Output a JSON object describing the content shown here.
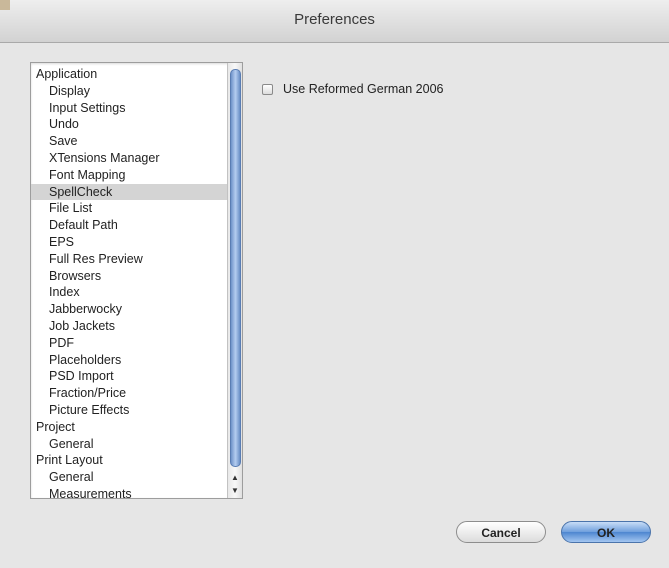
{
  "window": {
    "title": "Preferences"
  },
  "sidebar": {
    "items": [
      {
        "label": "Application",
        "level": 0
      },
      {
        "label": "Display",
        "level": 1
      },
      {
        "label": "Input Settings",
        "level": 1
      },
      {
        "label": "Undo",
        "level": 1
      },
      {
        "label": "Save",
        "level": 1
      },
      {
        "label": "XTensions Manager",
        "level": 1
      },
      {
        "label": "Font Mapping",
        "level": 1
      },
      {
        "label": "SpellCheck",
        "level": 1,
        "selected": true
      },
      {
        "label": "File List",
        "level": 1
      },
      {
        "label": "Default Path",
        "level": 1
      },
      {
        "label": "EPS",
        "level": 1
      },
      {
        "label": "Full Res Preview",
        "level": 1
      },
      {
        "label": "Browsers",
        "level": 1
      },
      {
        "label": "Index",
        "level": 1
      },
      {
        "label": "Jabberwocky",
        "level": 1
      },
      {
        "label": "Job Jackets",
        "level": 1
      },
      {
        "label": "PDF",
        "level": 1
      },
      {
        "label": "Placeholders",
        "level": 1
      },
      {
        "label": "PSD Import",
        "level": 1
      },
      {
        "label": "Fraction/Price",
        "level": 1
      },
      {
        "label": "Picture Effects",
        "level": 1
      },
      {
        "label": "Project",
        "level": 0
      },
      {
        "label": "General",
        "level": 1
      },
      {
        "label": "Print Layout",
        "level": 0
      },
      {
        "label": "General",
        "level": 1
      },
      {
        "label": "Measurements",
        "level": 1
      }
    ]
  },
  "scrollbar": {
    "up_arrow": "▲",
    "down_arrow": "▼"
  },
  "spellcheck": {
    "option_label": "Use Reformed German 2006",
    "checked": false
  },
  "buttons": {
    "cancel": "Cancel",
    "ok": "OK"
  },
  "colors": {
    "accent": "#6f9fdc",
    "selection": "#d4d4d4"
  }
}
